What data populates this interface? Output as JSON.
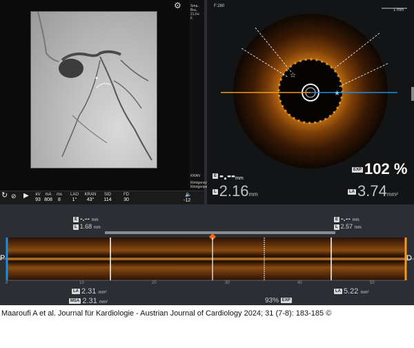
{
  "angiography": {
    "right_strip_lines": [
      "Sma..",
      "Bra..",
      "21.Fe",
      "F.",
      "KRAN",
      "Röntgensys",
      "Röntgenperiode"
    ],
    "bottom_bar": [
      {
        "label": "kV",
        "value": "93"
      },
      {
        "label": "mA",
        "value": "808"
      },
      {
        "label": "ms",
        "value": "8"
      },
      {
        "label": "LAO",
        "value": "1°"
      },
      {
        "label": "KRAN",
        "value": "43°"
      },
      {
        "label": "SID",
        "value": "114"
      },
      {
        "label": "FD",
        "value": "30"
      }
    ],
    "angle_readout": "-12"
  },
  "oct": {
    "frame": "F:280",
    "scale": "1 mm",
    "e_value": "-.--",
    "e_unit": "mm",
    "exp_value": "102 %",
    "l_value": "2.16",
    "l_unit": "mm",
    "la_value": "3.74",
    "la_unit": "mm²"
  },
  "longitudinal": {
    "left_ref": {
      "e_value": "-.--",
      "e_unit": "mm",
      "l_value": "1.68",
      "l_unit": "mm"
    },
    "right_ref": {
      "e_value": "-.--",
      "e_unit": "mm",
      "l_value": "2.57",
      "l_unit": "mm"
    },
    "proximal": "P",
    "distal": "D",
    "axis_ticks": [
      "0",
      "10",
      "20",
      "30",
      "40",
      "50"
    ],
    "min_la": "2.31",
    "min_la_unit": "mm²",
    "msa": "2.31",
    "msa_unit": "mm²",
    "exp": "93%",
    "ref_la": "5.22",
    "ref_la_unit": "mm²"
  },
  "badges": {
    "e": "E",
    "l": "L",
    "exp": "EXP",
    "la": "LA",
    "msa": "MSA"
  },
  "caption": "Maaroufi A et al. Journal für Kardiologie - Austrian Journal of Cardiology 2024; 31 (7-8): 183-185 ©",
  "colors": {
    "orange": "#f39a1e",
    "blue": "#1e8fe0",
    "accent_marker": "#f06a1a"
  }
}
